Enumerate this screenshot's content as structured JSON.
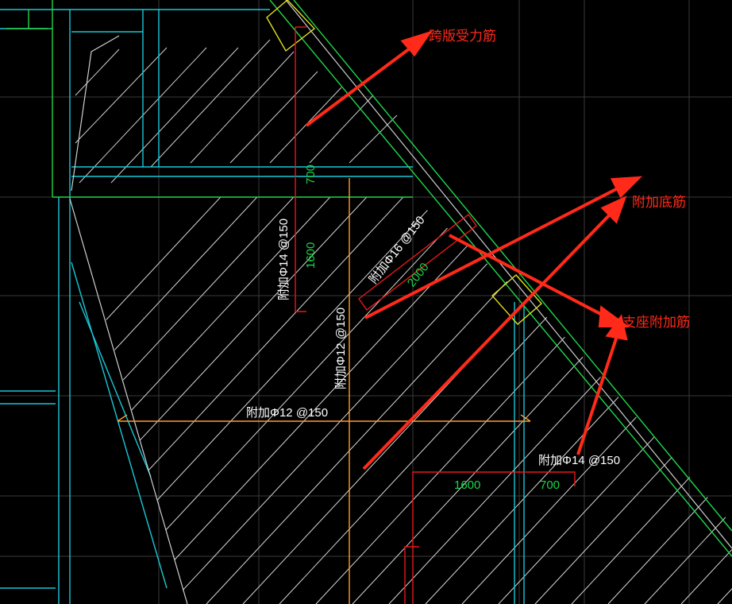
{
  "annotations": {
    "span_main_rebar": "跨版受力筋",
    "extra_bottom_rebar": "附加底筋",
    "support_extra_rebar": "支座附加筋"
  },
  "rebar_labels": {
    "left_vertical": "附加Φ14 @150",
    "diagonal": "附加Φ16 @150",
    "mid_vertical": "附加Φ12 @150",
    "horizontal": "附加Φ12 @150",
    "bottom_right": "附加Φ14 @150"
  },
  "dimensions": {
    "left_upper": "700",
    "left_lower": "1600",
    "diagonal": "2000",
    "bottom_left": "1600",
    "bottom_right": "700"
  },
  "colors": {
    "background": "#000000",
    "grid": "#3a3a3a",
    "cyan_lines": "#19c8d8",
    "green_lines": "#1fd84a",
    "hatch": "#d8d8d8",
    "orange_rebar": "#ff9a30",
    "red_rebar": "#e81818",
    "yellow_support": "#e0e020",
    "annotation_red": "#ff2a1a"
  }
}
